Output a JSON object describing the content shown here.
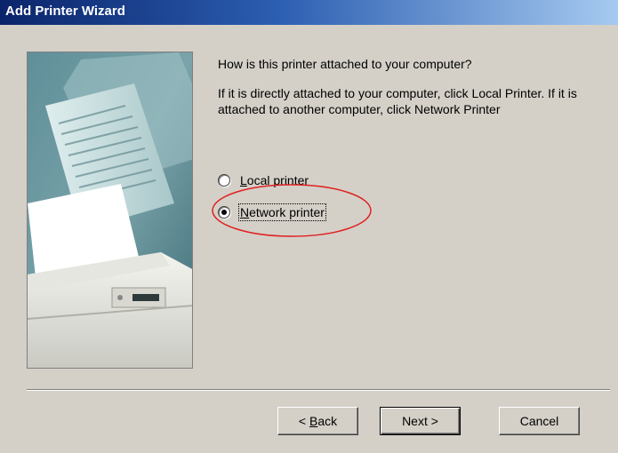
{
  "window": {
    "title": "Add Printer Wizard"
  },
  "main": {
    "question": "How is this printer attached to your computer?",
    "instructions": "If it is directly attached to your computer, click Local Printer. If it is attached to another computer, click Network Printer"
  },
  "options": [
    {
      "label_prefix": "L",
      "label_rest": "ocal printer",
      "checked": false
    },
    {
      "label_prefix": "N",
      "label_rest": "etwork printer",
      "checked": true
    }
  ],
  "buttons": {
    "back_prefix": "< ",
    "back_key": "B",
    "back_rest": "ack",
    "next": "Next >",
    "cancel": "Cancel"
  },
  "annotation": {
    "color": "#e02020",
    "shape": "ellipse around selected option"
  },
  "colors": {
    "titlebar_start": "#0a246a",
    "titlebar_end": "#a6caf0",
    "dialog_bg": "#d4d0c8"
  }
}
